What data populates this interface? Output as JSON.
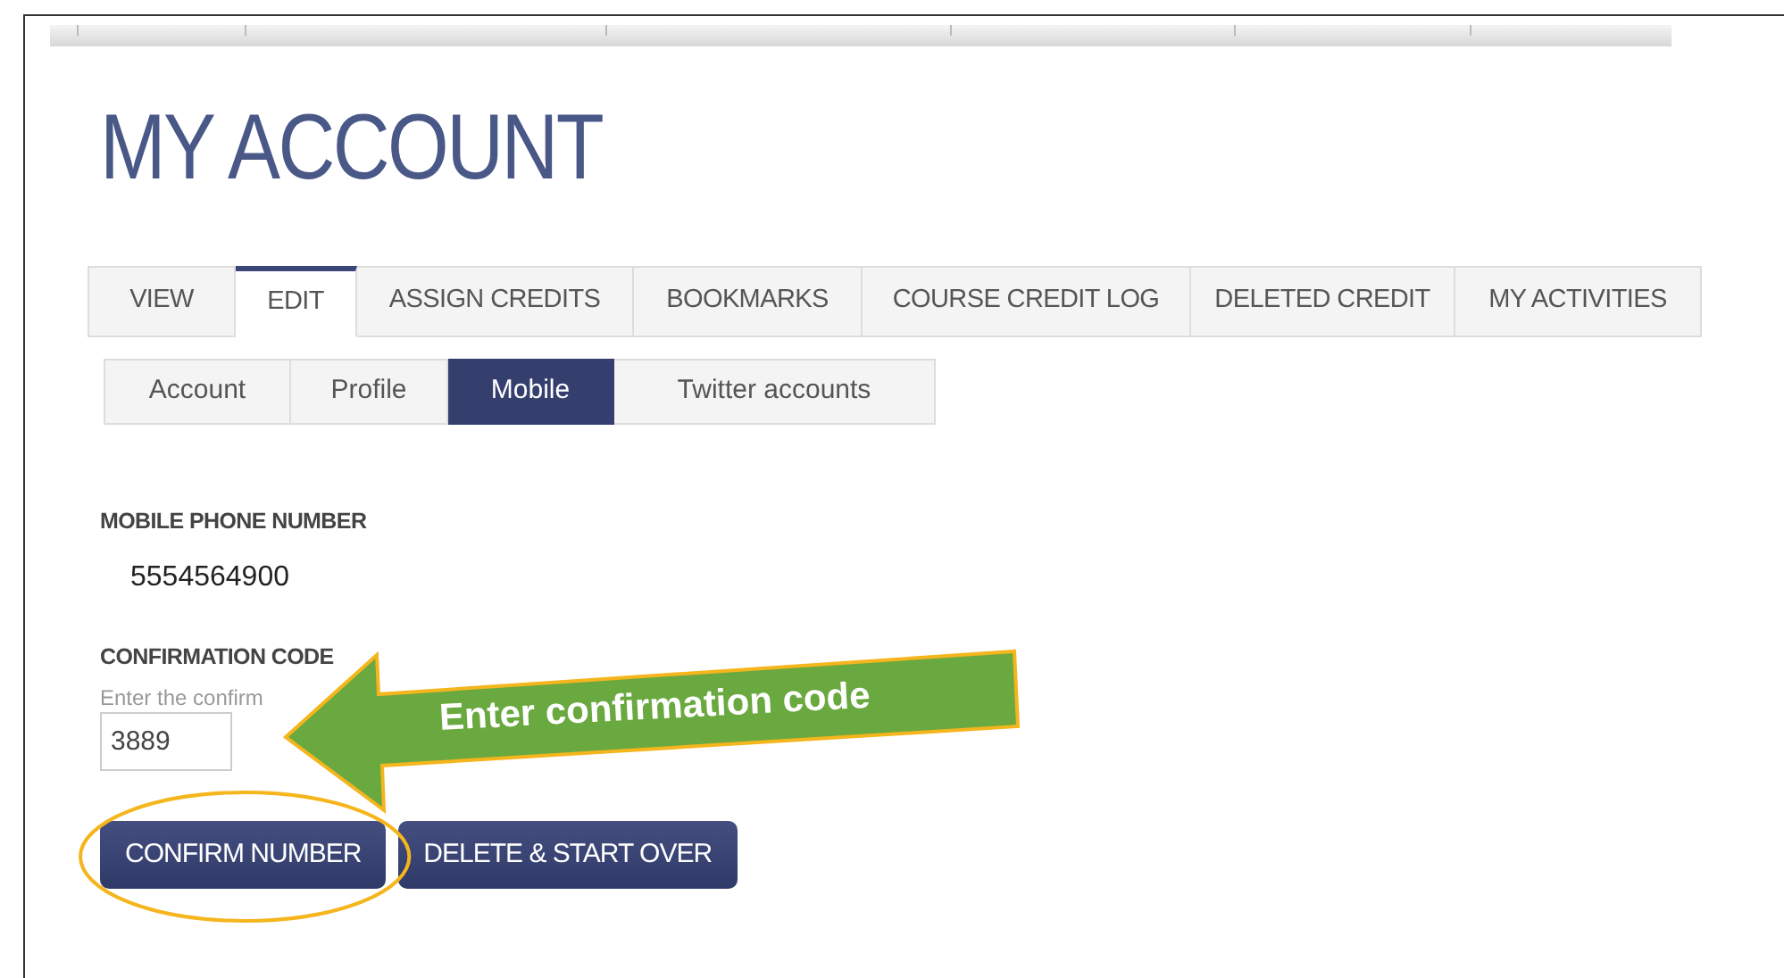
{
  "page": {
    "title": "MY ACCOUNT"
  },
  "tabs": [
    {
      "label": "VIEW",
      "selected": false
    },
    {
      "label": "EDIT",
      "selected": true
    },
    {
      "label": "ASSIGN CREDITS",
      "selected": false
    },
    {
      "label": "BOOKMARKS",
      "selected": false
    },
    {
      "label": "COURSE CREDIT LOG",
      "selected": false
    },
    {
      "label": "DELETED CREDIT",
      "selected": false
    },
    {
      "label": "MY ACTIVITIES",
      "selected": false
    }
  ],
  "subtabs": [
    {
      "label": "Account",
      "selected": false
    },
    {
      "label": "Profile",
      "selected": false
    },
    {
      "label": "Mobile",
      "selected": true
    },
    {
      "label": "Twitter accounts",
      "selected": false
    }
  ],
  "mobile_phone": {
    "label": "MOBILE PHONE NUMBER",
    "value": "5554564900"
  },
  "confirmation": {
    "label": "CONFIRMATION CODE",
    "help": "Enter the confirm",
    "value": "3889"
  },
  "buttons": [
    {
      "label": "CONFIRM NUMBER",
      "highlighted": true
    },
    {
      "label": "DELETE & START OVER",
      "highlighted": false
    }
  ],
  "annotations": {
    "callout": "Enter confirmation code"
  }
}
